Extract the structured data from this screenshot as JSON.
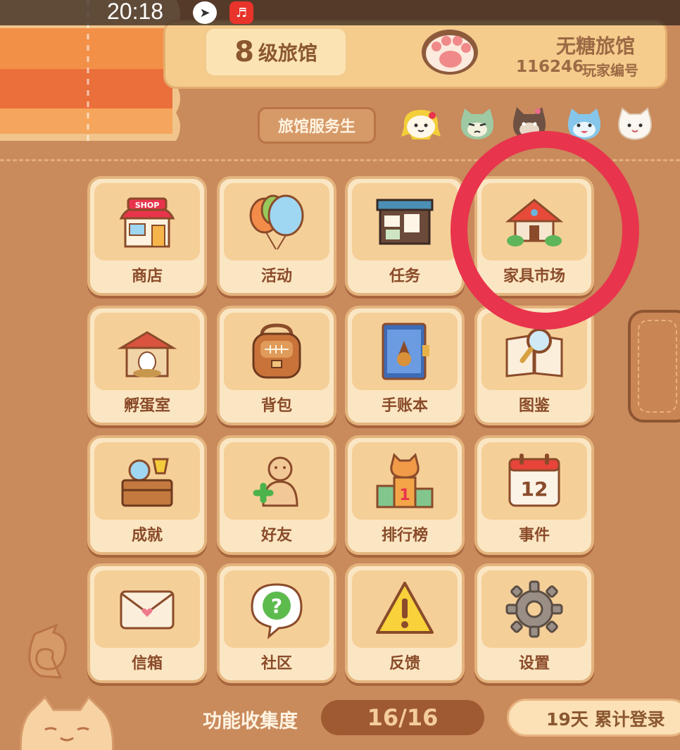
{
  "status": {
    "time": "20:18"
  },
  "header": {
    "level_number": "8",
    "level_text": "级旅馆",
    "inn_name": "无糖旅馆",
    "player_id": "116246",
    "player_id_label": "玩家编号",
    "staff_button": "旅馆服务生"
  },
  "grid": {
    "items": [
      {
        "label": "商店",
        "icon": "shop-icon"
      },
      {
        "label": "活动",
        "icon": "balloons-icon"
      },
      {
        "label": "任务",
        "icon": "task-board-icon"
      },
      {
        "label": "家具市场",
        "icon": "furniture-market-icon"
      },
      {
        "label": "孵蛋室",
        "icon": "hatchery-icon"
      },
      {
        "label": "背包",
        "icon": "backpack-icon"
      },
      {
        "label": "手账本",
        "icon": "journal-icon"
      },
      {
        "label": "图鉴",
        "icon": "encyclopedia-icon"
      },
      {
        "label": "成就",
        "icon": "trophy-chest-icon"
      },
      {
        "label": "好友",
        "icon": "add-friend-icon"
      },
      {
        "label": "排行榜",
        "icon": "leaderboard-icon"
      },
      {
        "label": "事件",
        "icon": "calendar-icon"
      },
      {
        "label": "信箱",
        "icon": "mail-icon"
      },
      {
        "label": "社区",
        "icon": "community-question-icon"
      },
      {
        "label": "反馈",
        "icon": "warning-icon"
      },
      {
        "label": "设置",
        "icon": "gear-icon"
      }
    ]
  },
  "footer": {
    "collect_label": "功能收集度",
    "collect_value": "16/16",
    "login_days": "19天 累计登录"
  },
  "calendar_day": "12",
  "leaderboard_rank": "1",
  "colors": {
    "highlight": "#e8344c",
    "tile_bg": "#fbe6c3",
    "page_bg": "#c98a5c"
  }
}
